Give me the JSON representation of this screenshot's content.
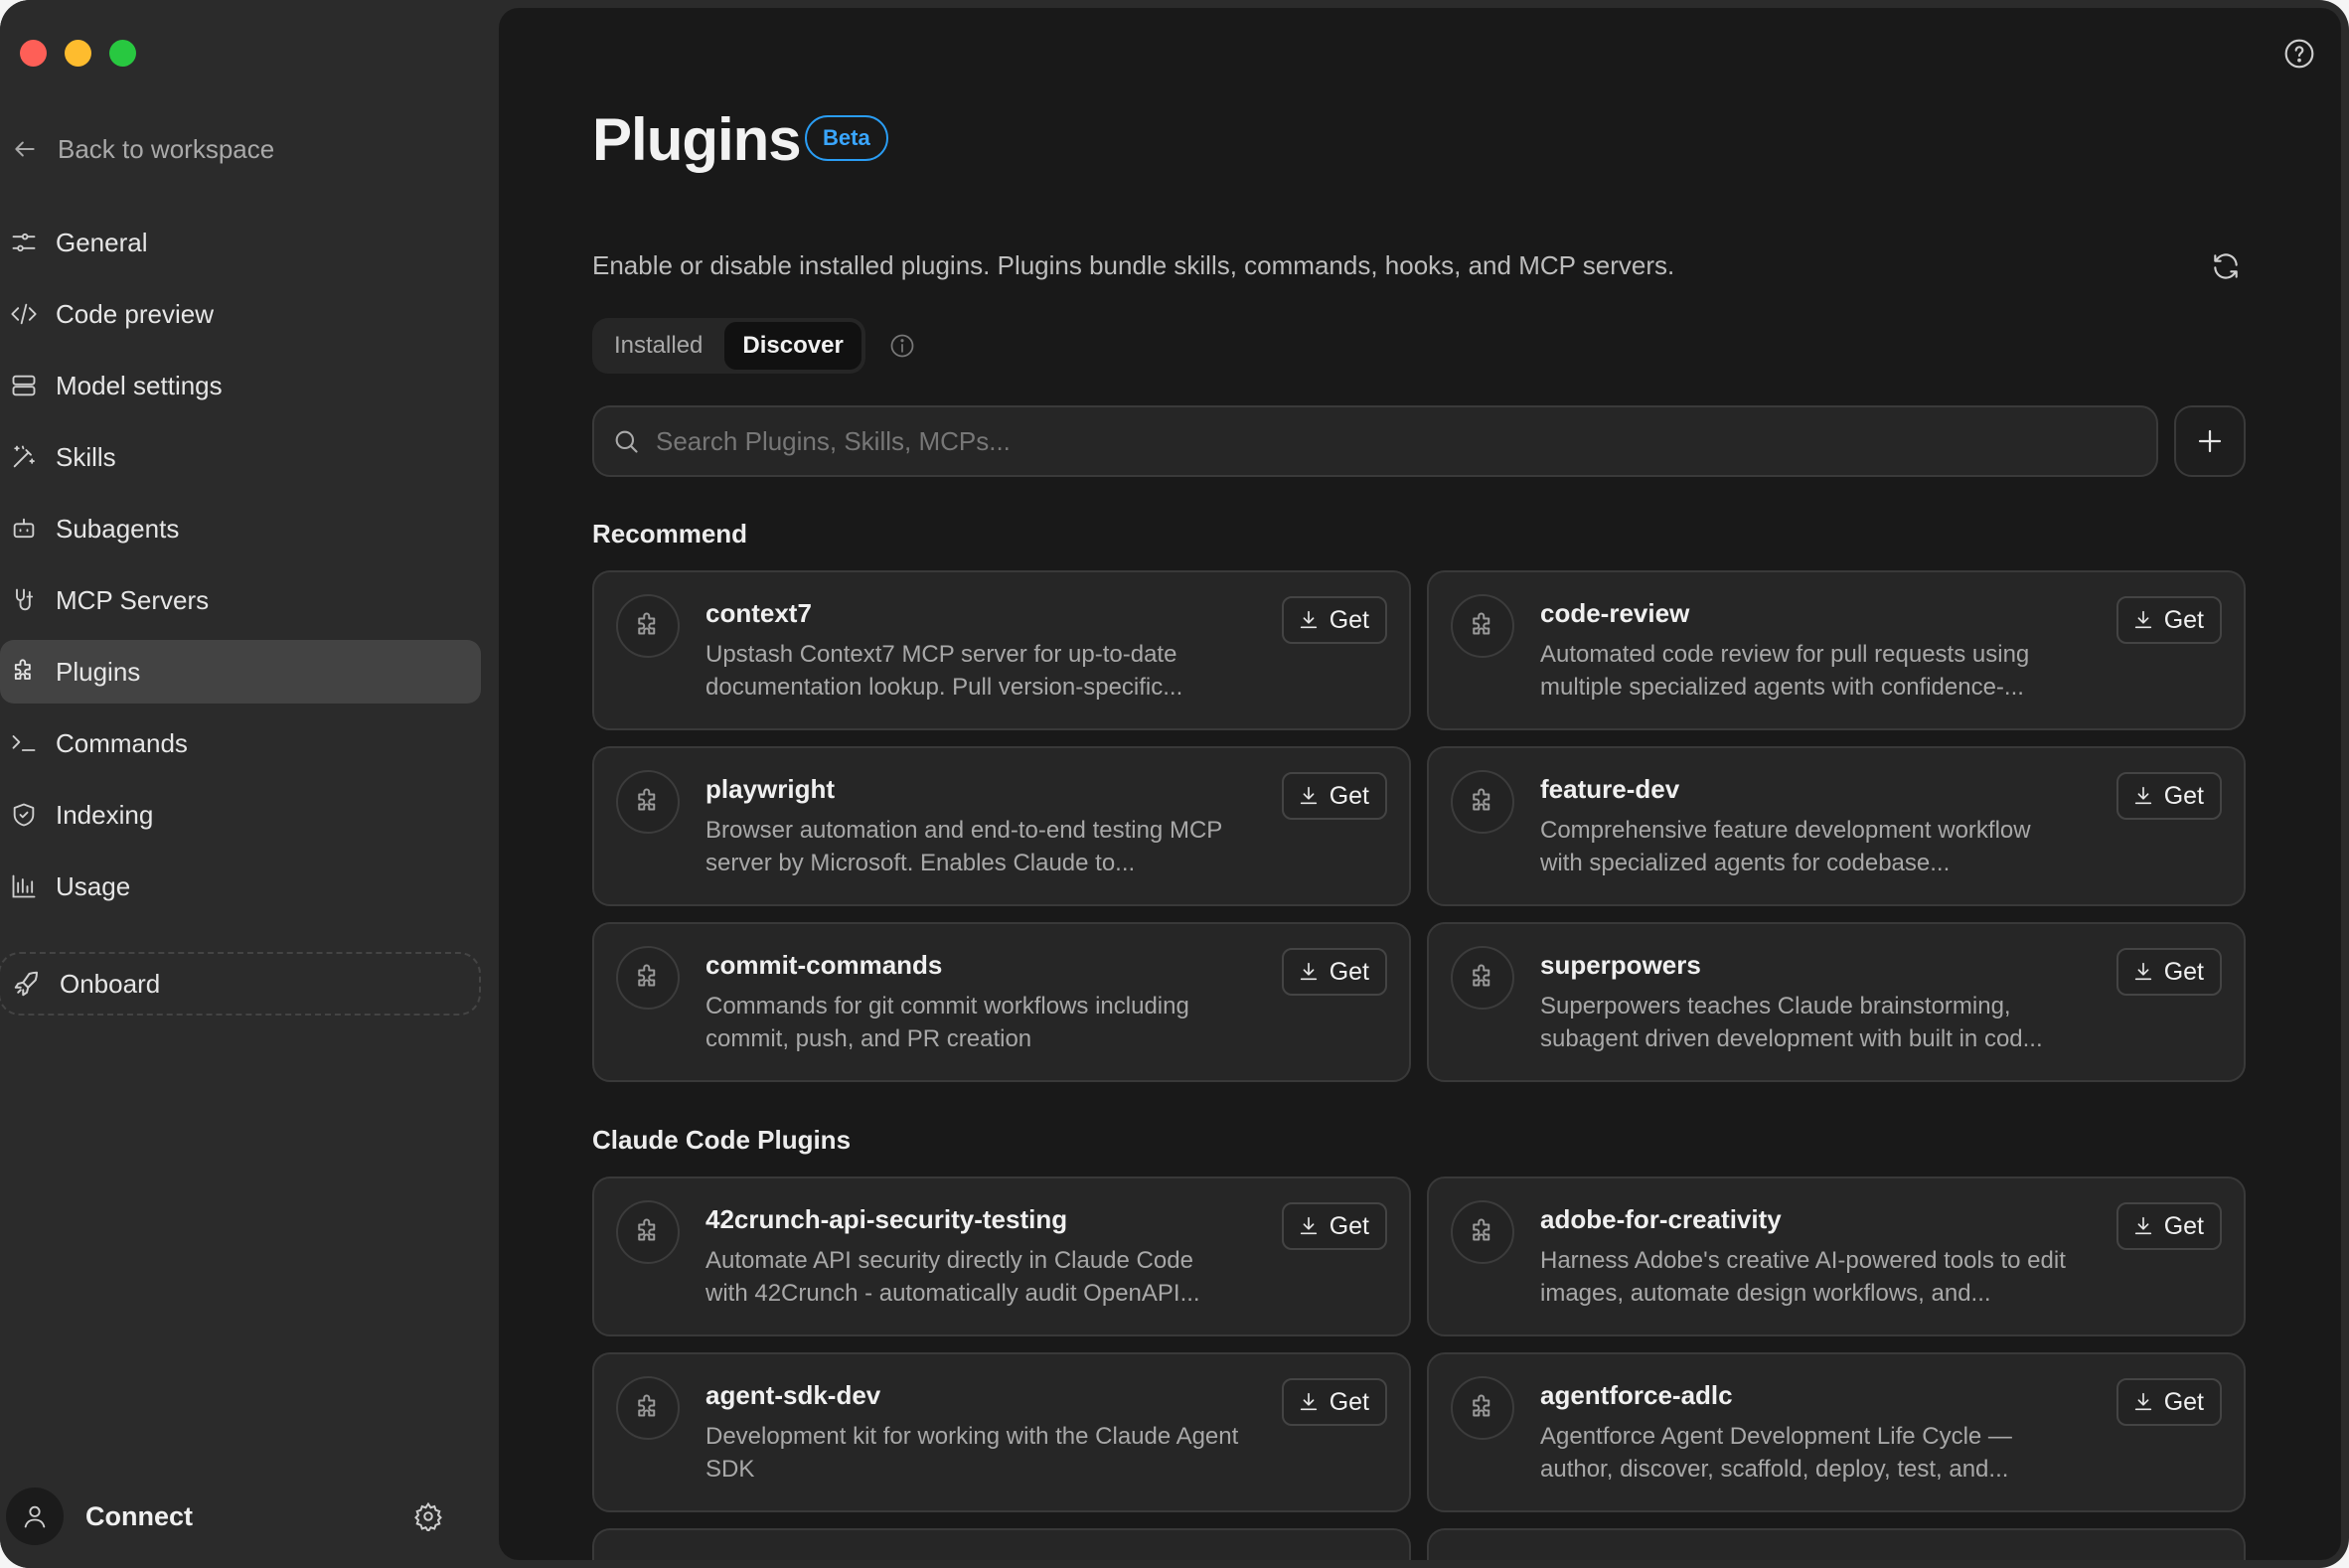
{
  "sidebar": {
    "back_label": "Back to workspace",
    "items": [
      {
        "label": "General",
        "icon": "sliders-icon"
      },
      {
        "label": "Code preview",
        "icon": "code-icon"
      },
      {
        "label": "Model settings",
        "icon": "server-icon"
      },
      {
        "label": "Skills",
        "icon": "magic-wand-icon"
      },
      {
        "label": "Subagents",
        "icon": "robot-icon"
      },
      {
        "label": "MCP Servers",
        "icon": "plug-icon"
      },
      {
        "label": "Plugins",
        "icon": "puzzle-icon",
        "active": true
      },
      {
        "label": "Commands",
        "icon": "terminal-icon"
      },
      {
        "label": "Indexing",
        "icon": "shield-icon"
      },
      {
        "label": "Usage",
        "icon": "bar-chart-icon"
      }
    ],
    "onboard_label": "Onboard",
    "connect_label": "Connect"
  },
  "header": {
    "title": "Plugins",
    "badge": "Beta",
    "description": "Enable or disable installed plugins. Plugins bundle skills, commands, hooks, and MCP servers."
  },
  "tabs": [
    {
      "label": "Installed",
      "active": false
    },
    {
      "label": "Discover",
      "active": true
    }
  ],
  "search": {
    "placeholder": "Search Plugins, Skills, MCPs..."
  },
  "get_label": "Get",
  "sections": [
    {
      "title": "Recommend",
      "plugins": [
        {
          "name": "context7",
          "desc": "Upstash Context7 MCP server for up-to-date documentation lookup. Pull version-specific..."
        },
        {
          "name": "code-review",
          "desc": "Automated code review for pull requests using multiple specialized agents with confidence-..."
        },
        {
          "name": "playwright",
          "desc": "Browser automation and end-to-end testing MCP server by Microsoft. Enables Claude to..."
        },
        {
          "name": "feature-dev",
          "desc": "Comprehensive feature development workflow with specialized agents for codebase..."
        },
        {
          "name": "commit-commands",
          "desc": "Commands for git commit workflows including commit, push, and PR creation"
        },
        {
          "name": "superpowers",
          "desc": "Superpowers teaches Claude brainstorming, subagent driven development with built in cod..."
        }
      ]
    },
    {
      "title": "Claude Code Plugins",
      "plugins": [
        {
          "name": "42crunch-api-security-testing",
          "desc": "Automate API security directly in Claude Code with 42Crunch - automatically audit OpenAPI..."
        },
        {
          "name": "adobe-for-creativity",
          "desc": "Harness Adobe's creative AI-powered tools to edit images, automate design workflows, and..."
        },
        {
          "name": "agent-sdk-dev",
          "desc": "Development kit for working with the Claude Agent SDK"
        },
        {
          "name": "agentforce-adlc",
          "desc": "Agentforce Agent Development Life Cycle — author, discover, scaffold, deploy, test, and..."
        }
      ]
    }
  ],
  "colors": {
    "accent": "#2a9df4",
    "sidebar_bg": "#2b2b2b",
    "main_bg": "#191919",
    "card_bg": "#262626"
  }
}
